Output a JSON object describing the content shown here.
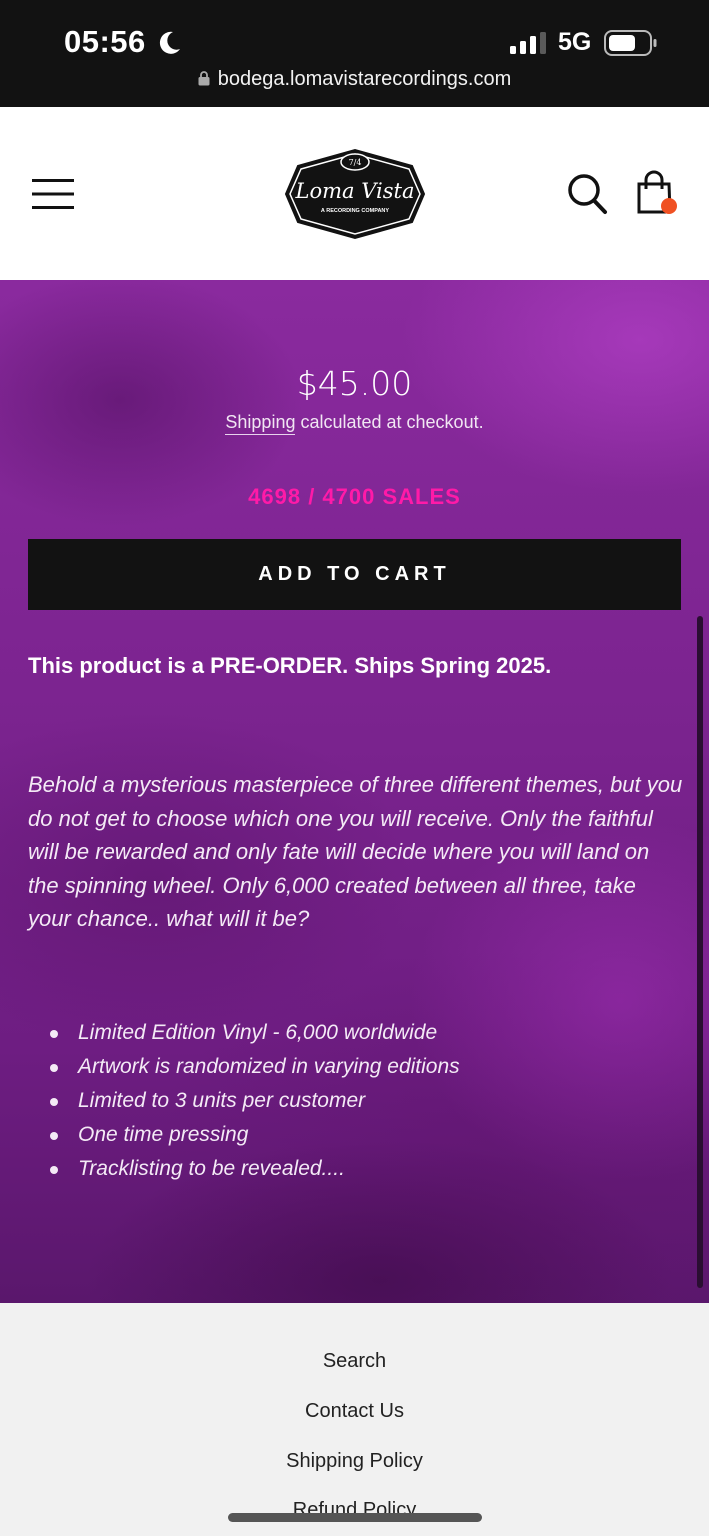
{
  "status_bar": {
    "time": "05:56",
    "network": "5G",
    "url": "bodega.lomavistarecordings.com",
    "icons": [
      "moon-icon",
      "signal-icon",
      "battery-icon",
      "lock-icon"
    ]
  },
  "header": {
    "logo": {
      "top": "7/4",
      "name": "Loma Vista",
      "tagline": "A RECORDING COMPANY"
    },
    "icons": [
      "menu-icon",
      "search-icon",
      "cart-icon"
    ],
    "cart_badge_color": "#f05123"
  },
  "product": {
    "price": "$45.00",
    "shipping_link": "Shipping",
    "shipping_rest": " calculated at checkout.",
    "sales_counter": "4698 / 4700 SALES",
    "add_to_cart": "ADD TO CART",
    "preorder_note": "This product is a PRE-ORDER. Ships Spring 2025.",
    "description": "Behold a mysterious masterpiece of three different themes, but you do not get to choose which one you will receive. Only the faithful will be rewarded and only fate will decide where you will land on the spinning wheel. Only 6,000 created between all three, take your chance.. what will it be?",
    "features": [
      "Limited Edition Vinyl  - 6,000 worldwide",
      "Artwork is randomized in varying editions",
      "Limited to 3 units per customer",
      "One time pressing",
      "Tracklisting to be revealed...."
    ],
    "colors": {
      "background": "#7c2490",
      "sales": "#ff1aa8",
      "button": "#121212"
    }
  },
  "footer": {
    "links": [
      "Search",
      "Contact Us",
      "Shipping Policy",
      "Refund Policy"
    ]
  }
}
